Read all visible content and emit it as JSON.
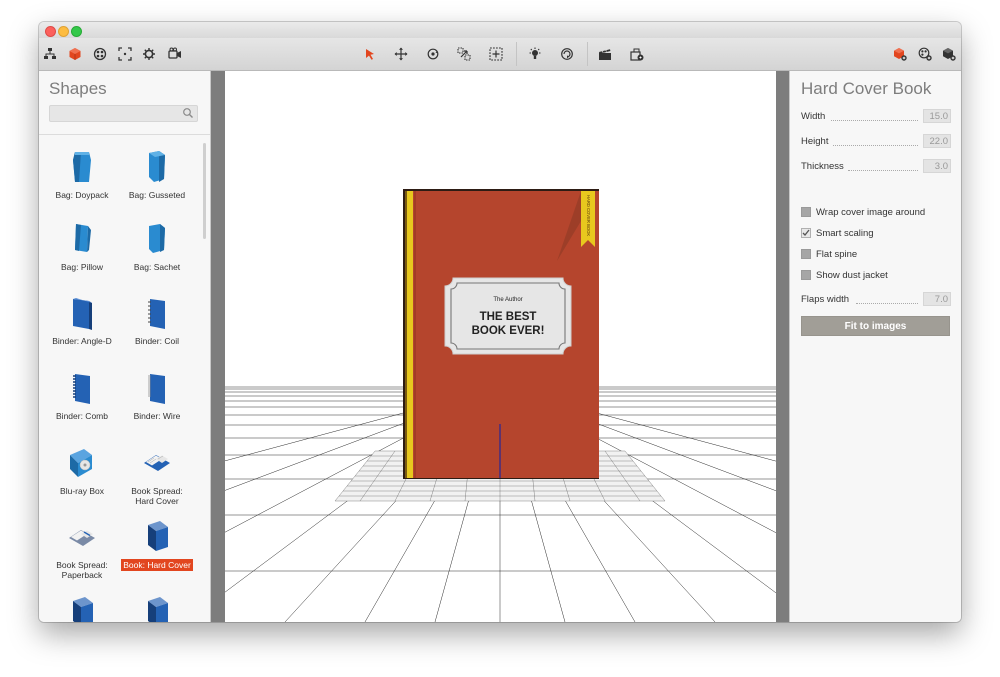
{
  "toolbar": {
    "left_icons": [
      "hierarchy-icon",
      "cube-icon",
      "materials-icon",
      "frame-icon",
      "gear-icon",
      "camera-icon"
    ],
    "center_icons": [
      "select-arrow-icon",
      "move-icon",
      "rotate-icon",
      "scale-icon",
      "fit-view-icon",
      "light-icon",
      "orbit-icon",
      "clapper-icon",
      "render-icon"
    ],
    "right_icons": [
      "add-shape-icon",
      "add-material-icon",
      "add-object-icon"
    ],
    "accent_color": "#e2461f"
  },
  "shapes_panel": {
    "title": "Shapes",
    "search_placeholder": "",
    "items": [
      {
        "label": "Bag: Doypack",
        "icon": "bag-doypack-icon"
      },
      {
        "label": "Bag: Gusseted",
        "icon": "bag-gusseted-icon"
      },
      {
        "label": "Bag: Pillow",
        "icon": "bag-pillow-icon"
      },
      {
        "label": "Bag: Sachet",
        "icon": "bag-sachet-icon"
      },
      {
        "label": "Binder: Angle-D",
        "icon": "binder-angle-d-icon"
      },
      {
        "label": "Binder: Coil",
        "icon": "binder-coil-icon"
      },
      {
        "label": "Binder: Comb",
        "icon": "binder-comb-icon"
      },
      {
        "label": "Binder: Wire",
        "icon": "binder-wire-icon"
      },
      {
        "label": "Blu-ray Box",
        "icon": "bluray-box-icon"
      },
      {
        "label": "Book Spread: Hard Cover",
        "icon": "book-spread-hard-icon"
      },
      {
        "label": "Book Spread: Paperback",
        "icon": "book-spread-paperback-icon"
      },
      {
        "label": "Book: Hard Cover",
        "icon": "book-hard-cover-icon",
        "selected": true
      },
      {
        "label": "",
        "icon": "book-icon"
      },
      {
        "label": "",
        "icon": "book-icon"
      }
    ]
  },
  "book": {
    "author": "The Author",
    "title": "THE BEST BOOK EVER!",
    "ribbon_text": "HARD COVER BOOK",
    "cover_color": "#b5452d",
    "spine_color": "#e8c81e"
  },
  "properties": {
    "title": "Hard Cover Book",
    "width_label": "Width",
    "width_value": "15.0",
    "height_label": "Height",
    "height_value": "22.0",
    "thickness_label": "Thickness",
    "thickness_value": "3.0",
    "wrap_label": "Wrap cover image around",
    "wrap_checked": false,
    "smart_label": "Smart scaling",
    "smart_checked": true,
    "flat_label": "Flat spine",
    "flat_checked": false,
    "dust_label": "Show dust jacket",
    "dust_checked": false,
    "flaps_label": "Flaps width",
    "flaps_value": "7.0",
    "fit_button": "Fit to images"
  }
}
